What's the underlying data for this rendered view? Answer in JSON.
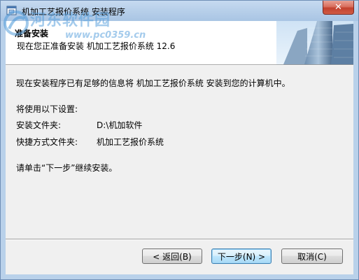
{
  "window": {
    "title": "机加工艺报价系统 安装程序",
    "close_glyph": "✕"
  },
  "watermark": {
    "text": "河东软件园",
    "url": "www.pc0359.cn"
  },
  "header": {
    "title": "准备安装",
    "subtitle": "现在您正准备安装 机加工艺报价系统 12.6"
  },
  "body": {
    "intro": "现在安装程序已有足够的信息将 机加工艺报价系统 安装到您的计算机中。",
    "settings_heading": "将使用以下设置:",
    "install_folder_label": "安装文件夹:",
    "install_folder_value": "D:\\机加软件",
    "shortcut_folder_label": "快捷方式文件夹:",
    "shortcut_folder_value": "机加工艺报价系统",
    "instruction": "请单击“下一步”继续安装。"
  },
  "buttons": {
    "back": "< 返回(B)",
    "next": "下一步(N) >",
    "cancel": "取消(C)"
  },
  "colors": {
    "titlebar": "#b9d1ea",
    "client": "#f0f0f0",
    "close": "#c7402d"
  },
  "icons": [
    "installer-app-icon",
    "close-icon",
    "building-banner-image",
    "watermark-logo"
  ]
}
